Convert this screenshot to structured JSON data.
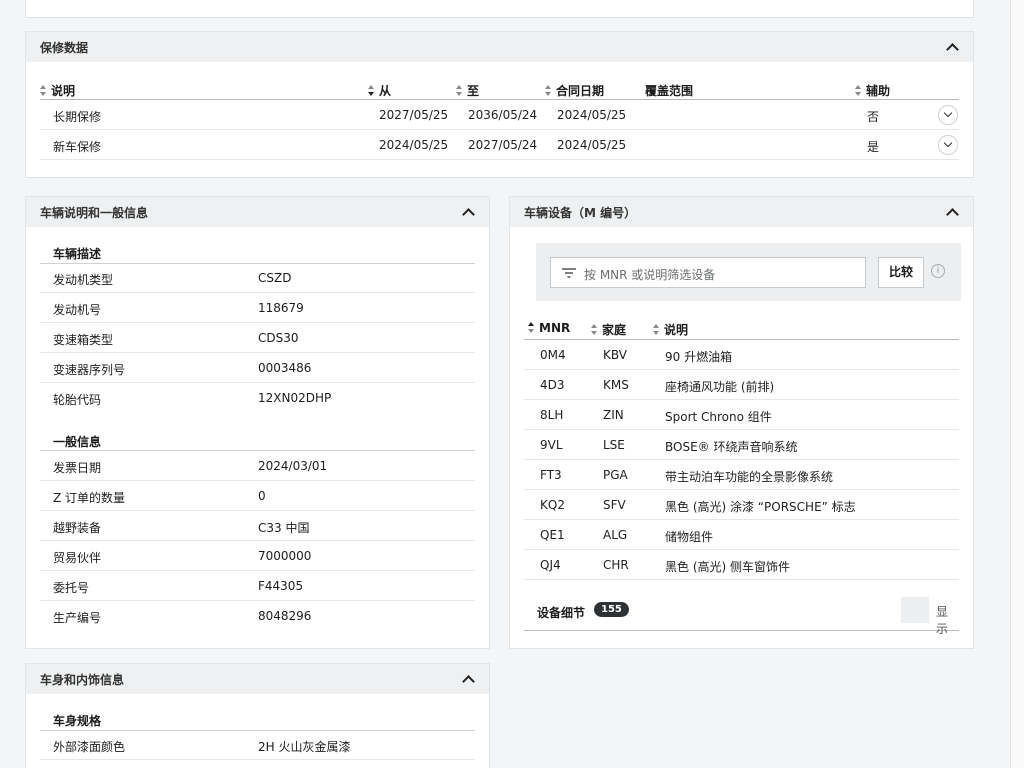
{
  "warranty": {
    "title": "保修数据",
    "columns": [
      "说明",
      "从",
      "至",
      "合同日期",
      "覆盖范围",
      "辅助"
    ],
    "rows": [
      {
        "desc": "长期保修",
        "from": "2027/05/25",
        "to": "2036/05/24",
        "contract": "2024/05/25",
        "coverage": "",
        "aux": "否"
      },
      {
        "desc": "新车保修",
        "from": "2024/05/25",
        "to": "2027/05/24",
        "contract": "2024/05/25",
        "coverage": "",
        "aux": "是"
      }
    ]
  },
  "vehicle_info": {
    "title": "车辆说明和一般信息",
    "section1_title": "车辆描述",
    "section1": [
      {
        "k": "发动机类型",
        "v": "CSZD"
      },
      {
        "k": "发动机号",
        "v": "118679"
      },
      {
        "k": "变速箱类型",
        "v": "CDS30"
      },
      {
        "k": "变速器序列号",
        "v": "0003486"
      },
      {
        "k": "轮胎代码",
        "v": "12XN02DHP"
      }
    ],
    "section2_title": "一般信息",
    "section2": [
      {
        "k": "发票日期",
        "v": "2024/03/01"
      },
      {
        "k": "Z 订单的数量",
        "v": "0"
      },
      {
        "k": "越野装备",
        "v": "C33 中国"
      },
      {
        "k": "贸易伙伴",
        "v": "7000000"
      },
      {
        "k": "委托号",
        "v": "F44305"
      },
      {
        "k": "生产编号",
        "v": "8048296"
      }
    ]
  },
  "body_info": {
    "title": "车身和内饰信息",
    "section_title": "车身规格",
    "rows": [
      {
        "k": "外部漆面颜色",
        "v": "2H 火山灰金属漆"
      }
    ]
  },
  "equipment": {
    "title": "车辆设备（M 编号）",
    "filter_placeholder": "按 MNR 或说明筛选设备",
    "compare_label": "比较",
    "columns": [
      "MNR",
      "家庭",
      "说明"
    ],
    "rows": [
      {
        "mnr": "0M4",
        "family": "KBV",
        "desc": "90 升燃油箱"
      },
      {
        "mnr": "4D3",
        "family": "KMS",
        "desc": "座椅通风功能 (前排)"
      },
      {
        "mnr": "8LH",
        "family": "ZIN",
        "desc": "Sport Chrono 组件"
      },
      {
        "mnr": "9VL",
        "family": "LSE",
        "desc": "BOSE® 环绕声音响系统"
      },
      {
        "mnr": "FT3",
        "family": "PGA",
        "desc": "带主动泊车功能的全景影像系统"
      },
      {
        "mnr": "KQ2",
        "family": "SFV",
        "desc": "黑色 (高光) 涂漆 “PORSCHE” 标志"
      },
      {
        "mnr": "QE1",
        "family": "ALG",
        "desc": "储物组件"
      },
      {
        "mnr": "QJ4",
        "family": "CHR",
        "desc": "黑色 (高光) 侧车窗饰件"
      }
    ],
    "details_label": "设备细节",
    "details_count": "155",
    "show_label": "显示"
  }
}
